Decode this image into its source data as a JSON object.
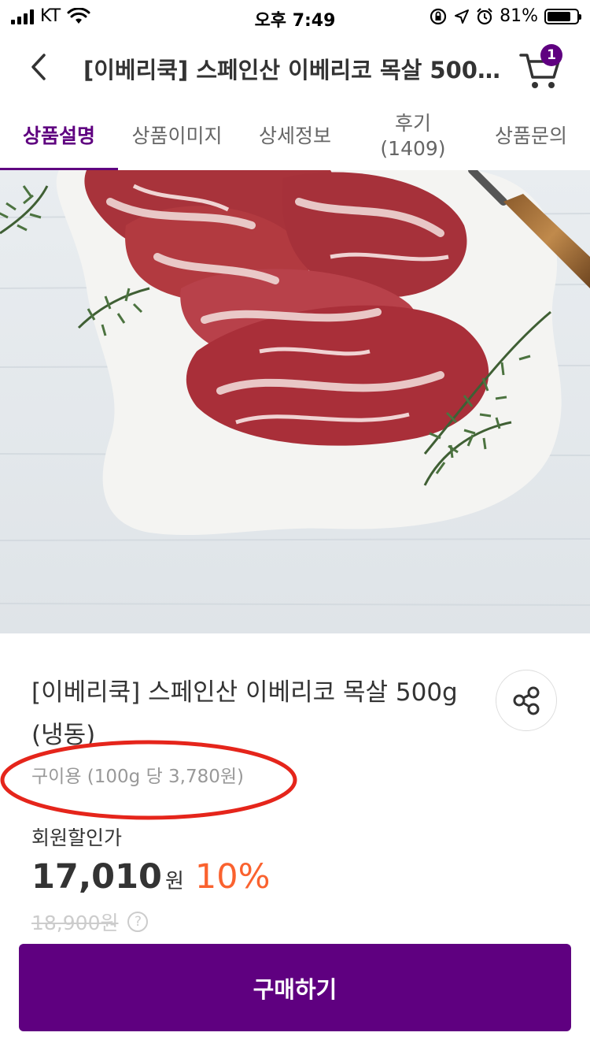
{
  "status_bar": {
    "carrier": "KT",
    "time": "오후 7:49",
    "battery_text": "81%",
    "battery_level": 0.81
  },
  "header": {
    "title": "[이베리쿡] 스페인산 이베리코 목살 500g (냉동)",
    "cart_count": "1"
  },
  "tabs": [
    {
      "label": "상품설명",
      "active": true
    },
    {
      "label": "상품이미지",
      "active": false
    },
    {
      "label": "상세정보",
      "active": false
    },
    {
      "label": "후기",
      "sub": "(1409)",
      "active": false
    },
    {
      "label": "상품문의",
      "active": false
    }
  ],
  "product": {
    "name": "[이베리쿡] 스페인산 이베리코 목살 500g (냉동)",
    "subdesc": "구이용 (100g 당 3,780원)",
    "member_price_label": "회원할인가",
    "price": "17,010",
    "currency": "원",
    "discount": "10%",
    "original_price": "18,900원",
    "help_icon_text": "?"
  },
  "buy_button": {
    "label": "구매하기"
  },
  "colors": {
    "brand": "#5f0080",
    "discount": "#fa622f",
    "highlight": "#e5251b"
  }
}
